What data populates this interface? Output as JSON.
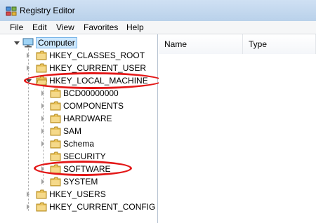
{
  "window": {
    "title": "Registry Editor"
  },
  "menu": [
    "File",
    "Edit",
    "View",
    "Favorites",
    "Help"
  ],
  "tree": {
    "root": "Computer",
    "hives": [
      "HKEY_CLASSES_ROOT",
      "HKEY_CURRENT_USER",
      "HKEY_LOCAL_MACHINE",
      "HKEY_USERS",
      "HKEY_CURRENT_CONFIG"
    ],
    "local_machine_children": [
      "BCD00000000",
      "COMPONENTS",
      "HARDWARE",
      "SAM",
      "Schema",
      "SECURITY",
      "SOFTWARE",
      "SYSTEM"
    ]
  },
  "list": {
    "columns": [
      "Name",
      "Type"
    ]
  },
  "colors": {
    "annotation": "#e31818",
    "folder": "#e9c25a"
  }
}
